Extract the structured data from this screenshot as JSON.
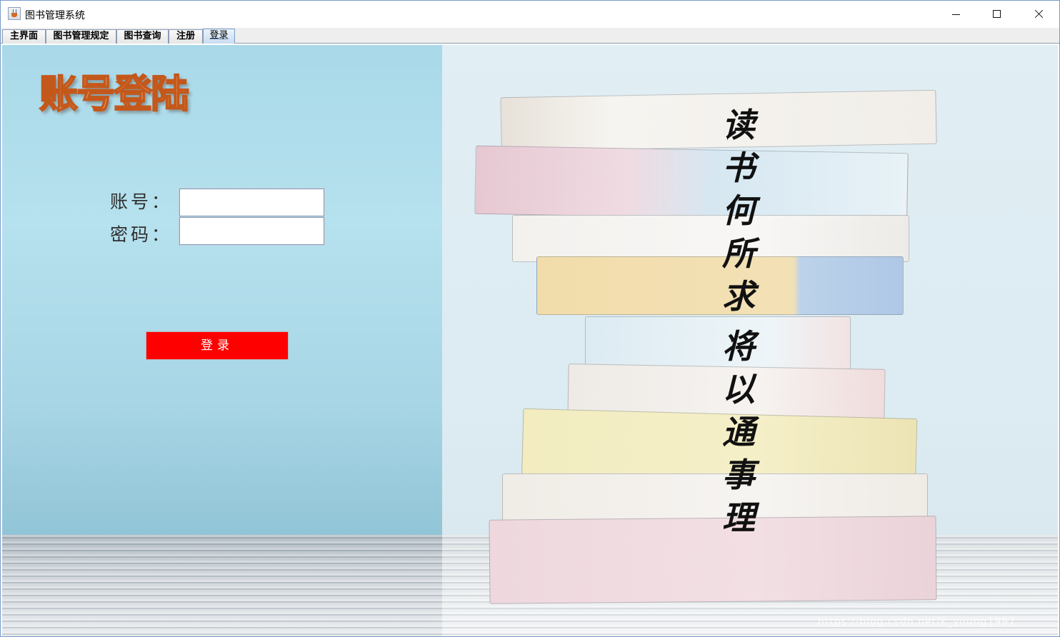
{
  "window": {
    "title": "图书管理系统",
    "icon": "java-cup-icon"
  },
  "tabs": [
    {
      "label": "主界面",
      "active": false
    },
    {
      "label": "图书管理规定",
      "active": false
    },
    {
      "label": "图书查询",
      "active": false
    },
    {
      "label": "注册",
      "active": false
    },
    {
      "label": "登录",
      "active": true
    }
  ],
  "login": {
    "heading": "账号登陆",
    "account_label": "账号：",
    "account_value": "",
    "password_label": "密码：",
    "password_value": "",
    "submit_label": "登录"
  },
  "poem": {
    "line1": [
      "读",
      "书",
      "何",
      "所",
      "求"
    ],
    "line2": [
      "将",
      "以",
      "通",
      "事",
      "理"
    ]
  },
  "watermark": "https://blog.csdn.net/k_young1997",
  "colors": {
    "submit_button": "#ff0000",
    "heading_fill": "#ffc89a",
    "heading_stroke": "#c4581b"
  }
}
